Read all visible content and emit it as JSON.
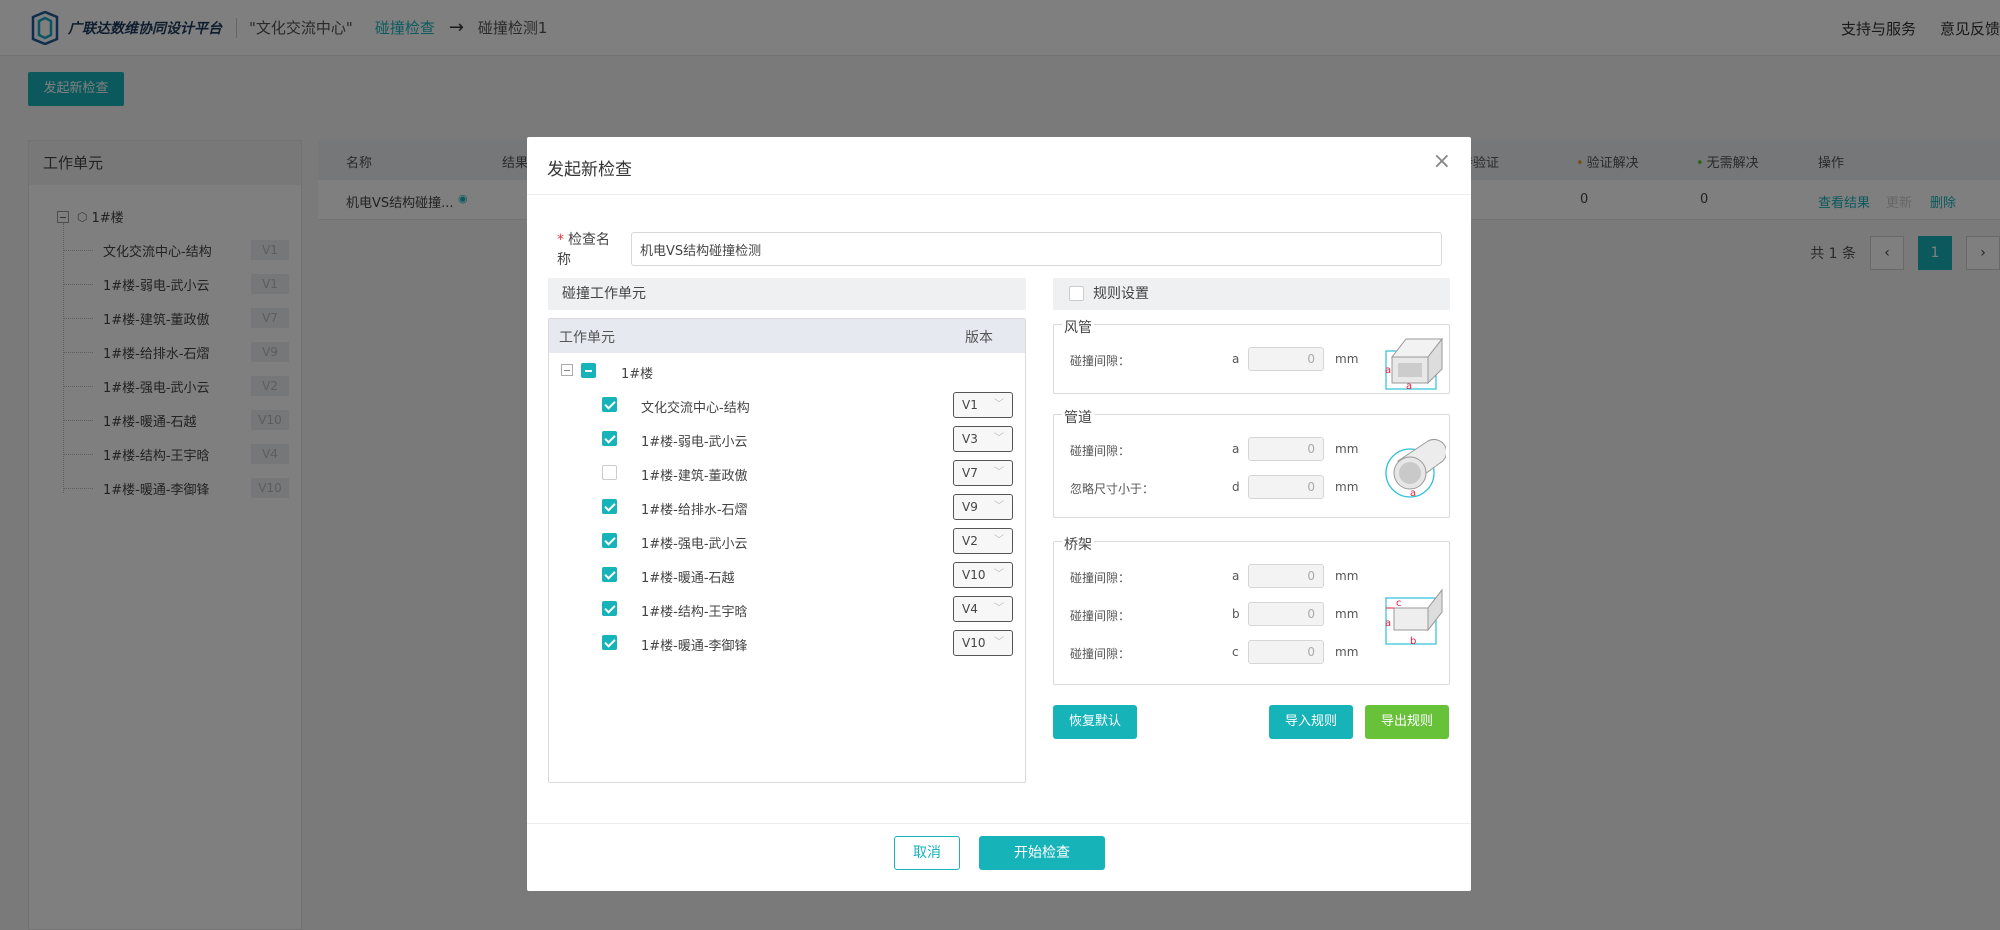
{
  "header": {
    "logo_text": "广联达数维协同设计平台",
    "project": "\"文化交流中心\"",
    "crumb_active": "碰撞检查",
    "crumb_arrow": "→",
    "crumb_current": "碰撞检测1",
    "support": "支持与服务",
    "feedback": "意见反馈"
  },
  "page": {
    "new_check_label": "发起新检查",
    "left_panel": {
      "title": "工作单元",
      "root": "1#楼",
      "items": [
        {
          "label": "文化交流中心-结构",
          "version": "V1"
        },
        {
          "label": "1#楼-弱电-武小云",
          "version": "V1"
        },
        {
          "label": "1#楼-建筑-董政傲",
          "version": "V7"
        },
        {
          "label": "1#楼-给排水-石熠",
          "version": "V9"
        },
        {
          "label": "1#楼-强电-武小云",
          "version": "V2"
        },
        {
          "label": "1#楼-暖通-石越",
          "version": "V10"
        },
        {
          "label": "1#楼-结构-王宇晗",
          "version": "V4"
        },
        {
          "label": "1#楼-暖通-李御锋",
          "version": "V10"
        }
      ]
    },
    "table": {
      "headers": {
        "name": "名称",
        "result": "结果",
        "pending": "待验证",
        "verified": "验证解决",
        "no_need": "无需解决",
        "ops": "操作"
      },
      "row": {
        "name": "机电VS结构碰撞...",
        "verified": "0",
        "no_need": "0",
        "view": "查看结果",
        "update": "更新",
        "delete": "删除"
      }
    },
    "pager": {
      "total": "共 1 条",
      "prev": "‹",
      "page": "1",
      "next": "›"
    }
  },
  "modal": {
    "title": "发起新检查",
    "close": "×",
    "name_label": "检查名称",
    "name_required": "*",
    "name_value": "机电VS结构碰撞检测",
    "units_section": "碰撞工作单元",
    "units_col_unit": "工作单元",
    "units_col_version": "版本",
    "units_root": "1#楼",
    "units": [
      {
        "label": "文化交流中心-结构",
        "version": "V1",
        "checked": true
      },
      {
        "label": "1#楼-弱电-武小云",
        "version": "V3",
        "checked": true
      },
      {
        "label": "1#楼-建筑-董政傲",
        "version": "V7",
        "checked": false
      },
      {
        "label": "1#楼-给排水-石熠",
        "version": "V9",
        "checked": true
      },
      {
        "label": "1#楼-强电-武小云",
        "version": "V2",
        "checked": true
      },
      {
        "label": "1#楼-暖通-石越",
        "version": "V10",
        "checked": true
      },
      {
        "label": "1#楼-结构-王宇晗",
        "version": "V4",
        "checked": true
      },
      {
        "label": "1#楼-暖通-李御锋",
        "version": "V10",
        "checked": true
      }
    ],
    "rules_section": "规则设置",
    "duct": {
      "legend": "风管",
      "rows": [
        {
          "label": "碰撞间隙：",
          "var": "a",
          "value": "0",
          "unit": "mm"
        }
      ]
    },
    "pipe": {
      "legend": "管道",
      "rows": [
        {
          "label": "碰撞间隙：",
          "var": "a",
          "value": "0",
          "unit": "mm"
        },
        {
          "label": "忽略尺寸小于：",
          "var": "d",
          "value": "0",
          "unit": "mm"
        }
      ]
    },
    "tray": {
      "legend": "桥架",
      "rows": [
        {
          "label": "碰撞间隙：",
          "var": "a",
          "value": "0",
          "unit": "mm"
        },
        {
          "label": "碰撞间隙：",
          "var": "b",
          "value": "0",
          "unit": "mm"
        },
        {
          "label": "碰撞间隙：",
          "var": "c",
          "value": "0",
          "unit": "mm"
        }
      ]
    },
    "diagram_letters": {
      "a": "a",
      "b": "b",
      "c": "c"
    },
    "restore_label": "恢复默认",
    "import_label": "导入规则",
    "export_label": "导出规则",
    "cancel_label": "取消",
    "start_label": "开始检查"
  },
  "colors": {
    "accent": "#16b3b9",
    "export": "#67c23a",
    "required": "#e4393c",
    "diagram": "#e0203a"
  }
}
